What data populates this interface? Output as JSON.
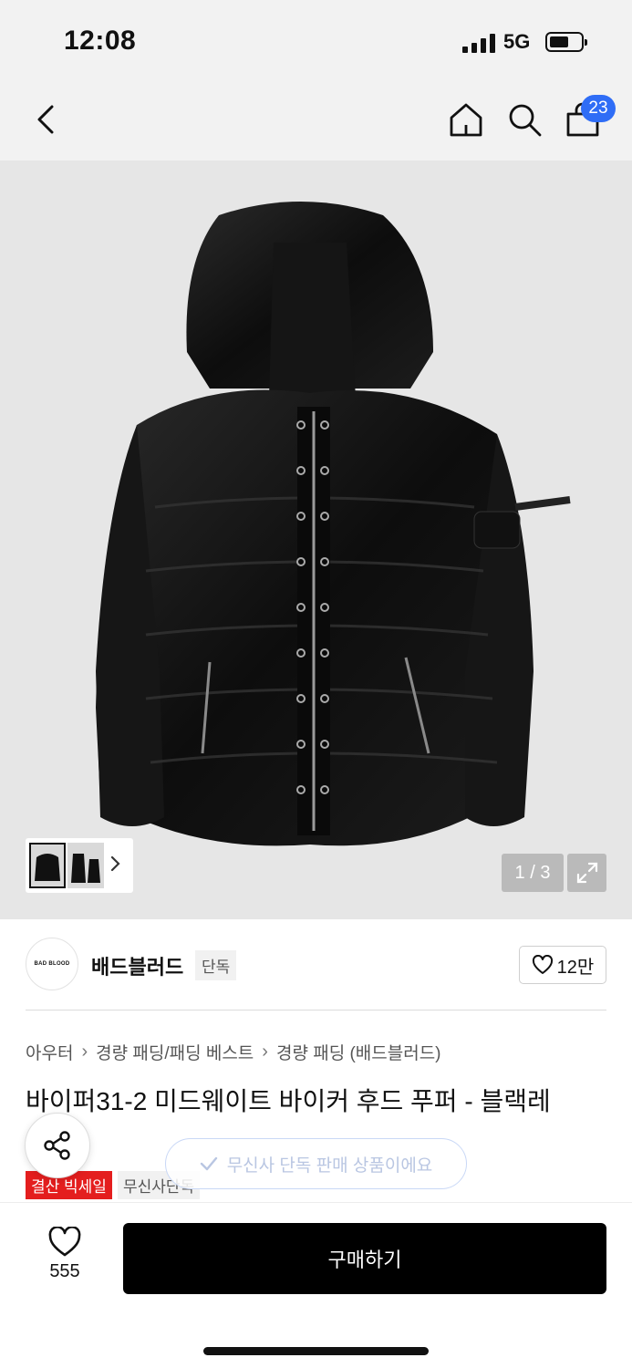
{
  "status_bar": {
    "time": "12:08",
    "network": "5G",
    "icons": [
      "signal-icon",
      "battery-icon"
    ]
  },
  "top_nav": {
    "icons": [
      "back-icon",
      "home-icon",
      "search-icon",
      "cart-icon"
    ],
    "cart_badge": "23",
    "accent_color": "#2f6df6"
  },
  "gallery": {
    "counter": "1 / 3",
    "icons": [
      "expand-icon",
      "chevron-right-icon"
    ]
  },
  "brand": {
    "logo_text": "BAD BLOOD",
    "name": "배드블러드",
    "tag": "단독",
    "likes": "12만"
  },
  "breadcrumb": [
    "아우터",
    "경량 패딩/패딩 베스트",
    "경량 패딩 (배드블러드)"
  ],
  "product": {
    "title": "바이퍼31-2 미드웨이트 바이커 후드 푸퍼 - 블랙레"
  },
  "overlay": {
    "exclusive_notice": "무신사 단독 판매 상품이에요"
  },
  "badges": {
    "sale": "결산 빅세일",
    "exclusive": "무신사단독"
  },
  "bottom_bar": {
    "wish_count": "555",
    "buy_label": "구매하기"
  },
  "colors": {
    "sale_badge": "#e41e1e",
    "buy_button": "#000000"
  }
}
